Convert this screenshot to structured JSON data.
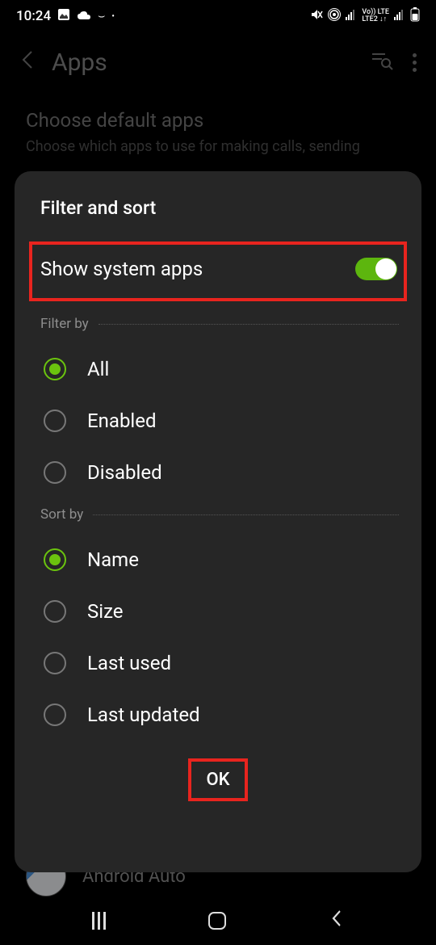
{
  "status": {
    "time": "10:24",
    "network_label": "LTE",
    "lte2_label": "Vo)) LTE\nLTE2"
  },
  "header": {
    "title": "Apps"
  },
  "background": {
    "choose_title": "Choose default apps",
    "choose_sub": "Choose which apps to use for making calls, sending",
    "app_name": "Android Auto"
  },
  "modal": {
    "title": "Filter and sort",
    "show_system_label": "Show system apps",
    "show_system_on": true,
    "filter_by_label": "Filter by",
    "filter_options": [
      "All",
      "Enabled",
      "Disabled"
    ],
    "filter_selected": 0,
    "sort_by_label": "Sort by",
    "sort_options": [
      "Name",
      "Size",
      "Last used",
      "Last updated"
    ],
    "sort_selected": 0,
    "ok_label": "OK"
  }
}
